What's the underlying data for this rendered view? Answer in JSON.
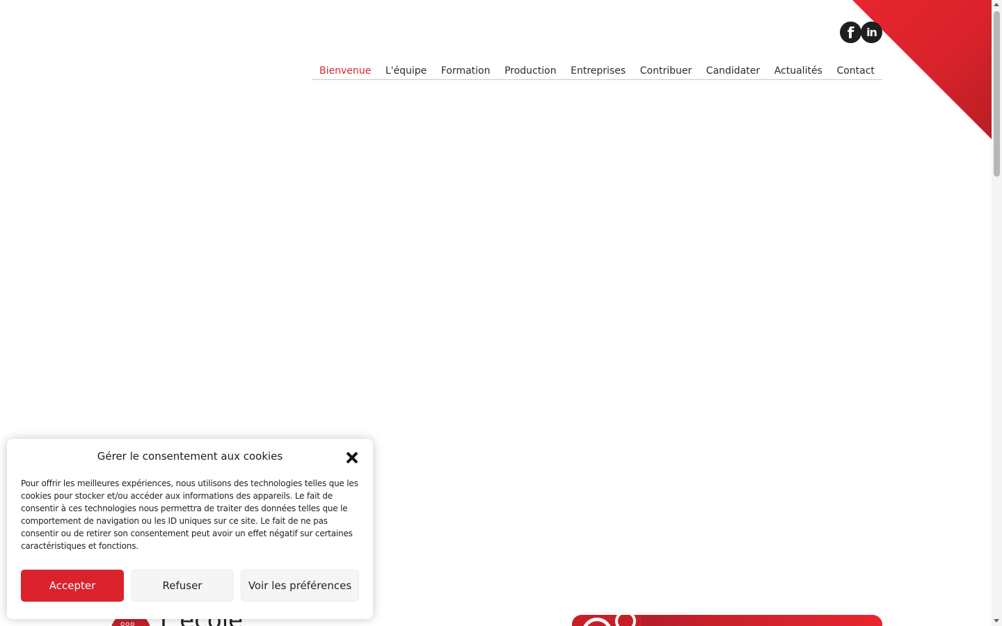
{
  "brand": {
    "accent_color": "#d9222b"
  },
  "social": [
    {
      "name": "facebook-icon",
      "glyph": "f"
    },
    {
      "name": "linkedin-icon",
      "glyph": "in"
    }
  ],
  "nav": {
    "items": [
      {
        "label": "Bienvenue",
        "active": true
      },
      {
        "label": "L'équipe"
      },
      {
        "label": "Formation"
      },
      {
        "label": "Production"
      },
      {
        "label": "Entreprises"
      },
      {
        "label": "Contribuer"
      },
      {
        "label": "Candidater"
      },
      {
        "label": "Actualités"
      },
      {
        "label": "Contact"
      }
    ]
  },
  "hero": {
    "title_partial": "L'école"
  },
  "cookie": {
    "title": "Gérer le consentement aux cookies",
    "text": "Pour offrir les meilleures expériences, nous utilisons des technologies telles que les cookies pour stocker et/ou accéder aux informations des appareils. Le fait de consentir à ces technologies nous permettra de traiter des données telles que le comportement de navigation ou les ID uniques sur ce site. Le fait de ne pas consentir ou de retirer son consentement peut avoir un effet négatif sur certaines caractéristiques et fonctions.",
    "accept_label": "Accepter",
    "refuse_label": "Refuser",
    "prefs_label": "Voir les préférences"
  }
}
